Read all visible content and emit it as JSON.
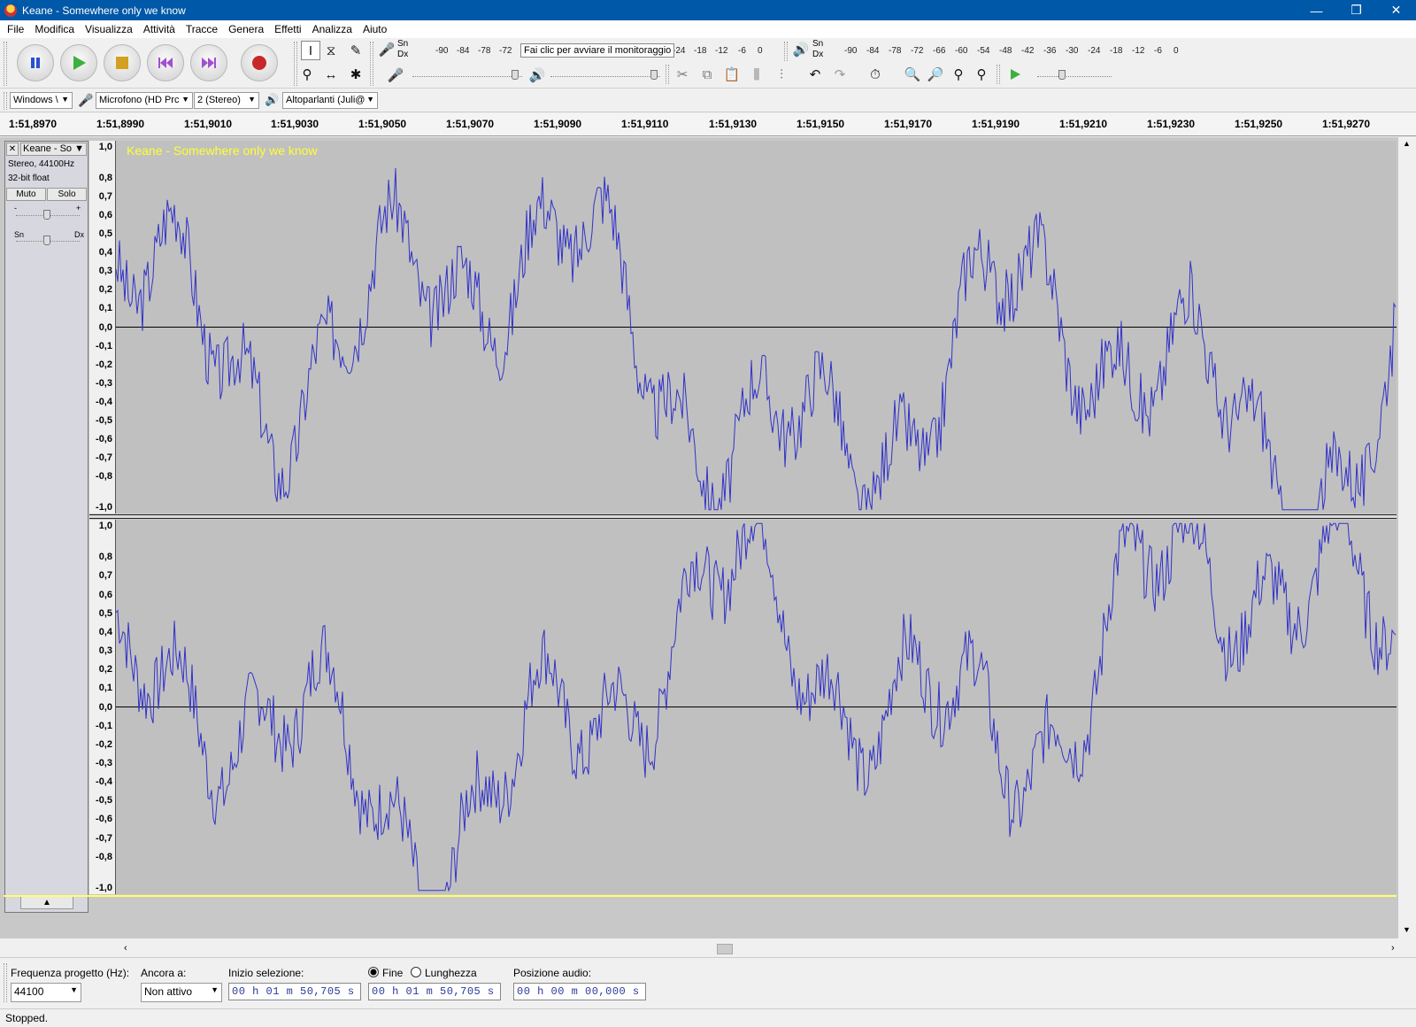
{
  "window": {
    "title": "Keane - Somewhere only we know",
    "minimize_glyph": "—",
    "restore_glyph": "❐",
    "close_glyph": "✕"
  },
  "menu": [
    "File",
    "Modifica",
    "Visualizza",
    "Attività",
    "Tracce",
    "Genera",
    "Effetti",
    "Analizza",
    "Aiuto"
  ],
  "meters": {
    "record_sn": "Sn",
    "record_dx": "Dx",
    "record_ticks": [
      "-90",
      "-84",
      "-78",
      "-72",
      "-24",
      "-18",
      "-12",
      "-6",
      "0"
    ],
    "monitor_tooltip": "Fai clic per avviare il monitoraggio",
    "play_sn": "Sn",
    "play_dx": "Dx",
    "play_ticks": [
      "-90",
      "-84",
      "-78",
      "-72",
      "-66",
      "-60",
      "-54",
      "-48",
      "-42",
      "-36",
      "-30",
      "-24",
      "-18",
      "-12",
      "-6",
      "0"
    ]
  },
  "devices": {
    "host": "Windows \\",
    "mic": "Microfono (HD Prc",
    "channels": "2 (Stereo)",
    "speakers": "Altoparlanti (Juli@"
  },
  "ruler": [
    "1:51,8970",
    "1:51,8990",
    "1:51,9010",
    "1:51,9030",
    "1:51,9050",
    "1:51,9070",
    "1:51,9090",
    "1:51,9110",
    "1:51,9130",
    "1:51,9150",
    "1:51,9170",
    "1:51,9190",
    "1:51,9210",
    "1:51,9230",
    "1:51,9250",
    "1:51,9270"
  ],
  "track": {
    "name": "Keane - So",
    "wave_title": "Keane - Somewhere only we know",
    "info1": "Stereo, 44100Hz",
    "info2": "32-bit float",
    "mute": "Muto",
    "solo": "Solo",
    "gain_minus": "-",
    "gain_plus": "+",
    "pan_left": "Sn",
    "pan_right": "Dx",
    "wave_color": "#3232c8"
  },
  "amplitude_ticks": [
    "1,0",
    "0,8",
    "0,7",
    "0,6",
    "0,5",
    "0,4",
    "0,3",
    "0,2",
    "0,1",
    "0,0",
    "-0,1",
    "-0,2",
    "-0,3",
    "-0,4",
    "-0,5",
    "-0,6",
    "-0,7",
    "-0,8",
    "-1,0"
  ],
  "selection": {
    "rate_label": "Frequenza progetto (Hz):",
    "rate_value": "44100",
    "snap_label": "Ancora a:",
    "snap_value": "Non attivo",
    "start_label": "Inizio selezione:",
    "start_value": "00 h 01 m 50,705 s",
    "end_label": "Fine",
    "length_label": "Lunghezza",
    "end_value": "00 h 01 m 50,705 s",
    "pos_label": "Posizione audio:",
    "pos_value": "00 h 00 m 00,000 s"
  },
  "status": "Stopped."
}
